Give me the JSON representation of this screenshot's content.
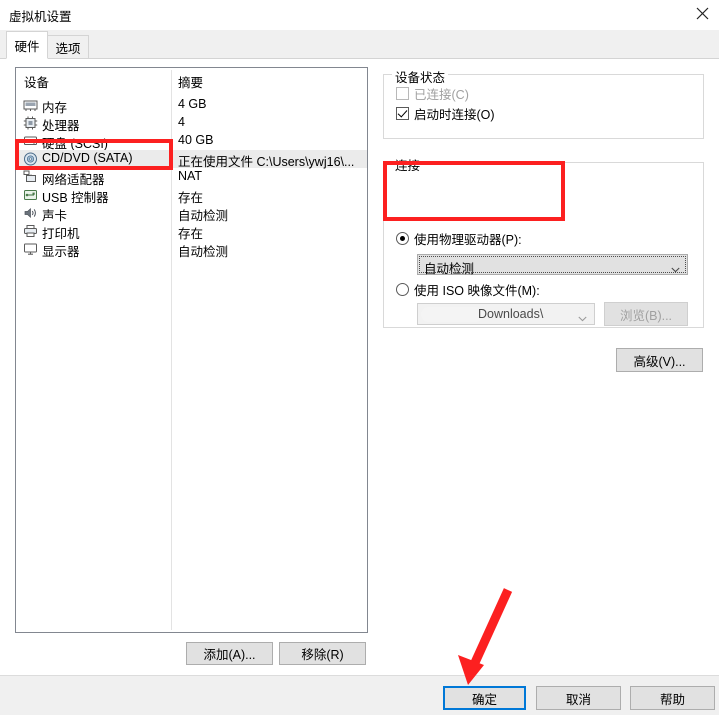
{
  "window": {
    "title": "虚拟机设置",
    "close_icon": "close-icon"
  },
  "tabs": [
    {
      "label": "硬件",
      "active": true
    },
    {
      "label": "选项",
      "active": false
    }
  ],
  "device_list": {
    "columns": {
      "device": "设备",
      "summary": "摘要"
    },
    "rows": [
      {
        "icon": "memory-icon",
        "label": "内存",
        "summary": "4 GB",
        "selected": false
      },
      {
        "icon": "cpu-icon",
        "label": "处理器",
        "summary": "4",
        "selected": false
      },
      {
        "icon": "harddisk-icon",
        "label": "硬盘 (SCSI)",
        "summary": "40 GB",
        "selected": false
      },
      {
        "icon": "cd-dvd-icon",
        "label": "CD/DVD (SATA)",
        "summary": "正在使用文件 C:\\Users\\ywj16\\...",
        "selected": true
      },
      {
        "icon": "network-icon",
        "label": "网络适配器",
        "summary": "NAT",
        "selected": false
      },
      {
        "icon": "usb-icon",
        "label": "USB 控制器",
        "summary": "存在",
        "selected": false
      },
      {
        "icon": "sound-icon",
        "label": "声卡",
        "summary": "自动检测",
        "selected": false
      },
      {
        "icon": "printer-icon",
        "label": "打印机",
        "summary": "存在",
        "selected": false
      },
      {
        "icon": "display-icon",
        "label": "显示器",
        "summary": "自动检测",
        "selected": false
      }
    ]
  },
  "list_buttons": {
    "add": "添加(A)...",
    "remove": "移除(R)"
  },
  "device_status": {
    "title": "设备状态",
    "connected": {
      "label": "已连接(C)",
      "checked": false,
      "disabled": true
    },
    "connect_at_power_on": {
      "label": "启动时连接(O)",
      "checked": true,
      "disabled": false
    }
  },
  "connection": {
    "title": "连接",
    "use_physical_drive": {
      "label": "使用物理驱动器(P):",
      "selected": true
    },
    "physical_drive_value": "自动检测",
    "use_iso_image": {
      "label": "使用 ISO 映像文件(M):",
      "selected": false
    },
    "iso_path_value": "Downloads\\",
    "browse_button": "浏览(B)...",
    "advanced_button": "高级(V)..."
  },
  "dialog_buttons": {
    "ok": "确定",
    "cancel": "取消",
    "help": "帮助"
  },
  "annotations": {
    "highlight_color": "#fc2020",
    "arrow_target": "确定"
  }
}
